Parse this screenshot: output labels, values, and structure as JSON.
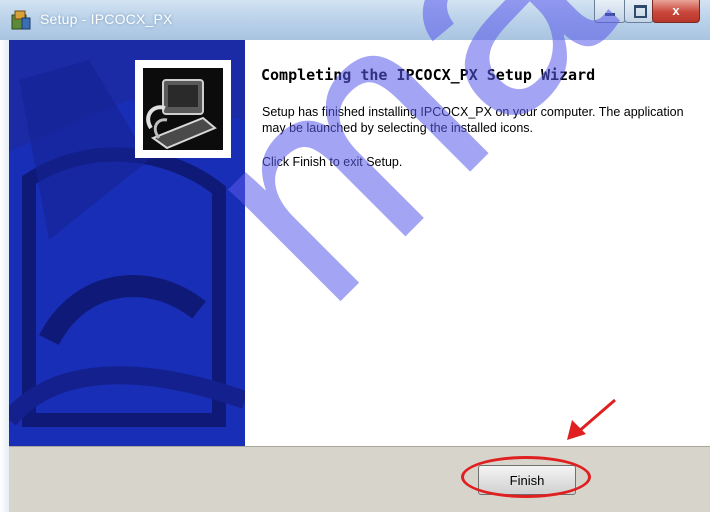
{
  "window": {
    "title": "Setup - IPCOCX_PX",
    "icon": "setup-installer-icon",
    "controls": {
      "minimize_icon": "minimize-icon",
      "maximize_icon": "maximize-icon",
      "close_glyph": "x",
      "close_color": "#c9473a"
    }
  },
  "wizard": {
    "heading": "Completing the IPCOCX_PX Setup Wizard",
    "description": "Setup has finished installing IPCOCX_PX on your computer. The application may be launched by selecting the installed icons.",
    "instruction": "Click Finish to exit Setup.",
    "side_panel_color": "#1b2ba6",
    "side_logo_icon": "computer-install-icon"
  },
  "footer": {
    "finish_label": "Finish"
  },
  "annotations": {
    "highlight_color": "#e02020",
    "arrow_icon": "red-arrow-pointer",
    "watermark": "matek",
    "watermark_color": "#5a5aeb"
  }
}
